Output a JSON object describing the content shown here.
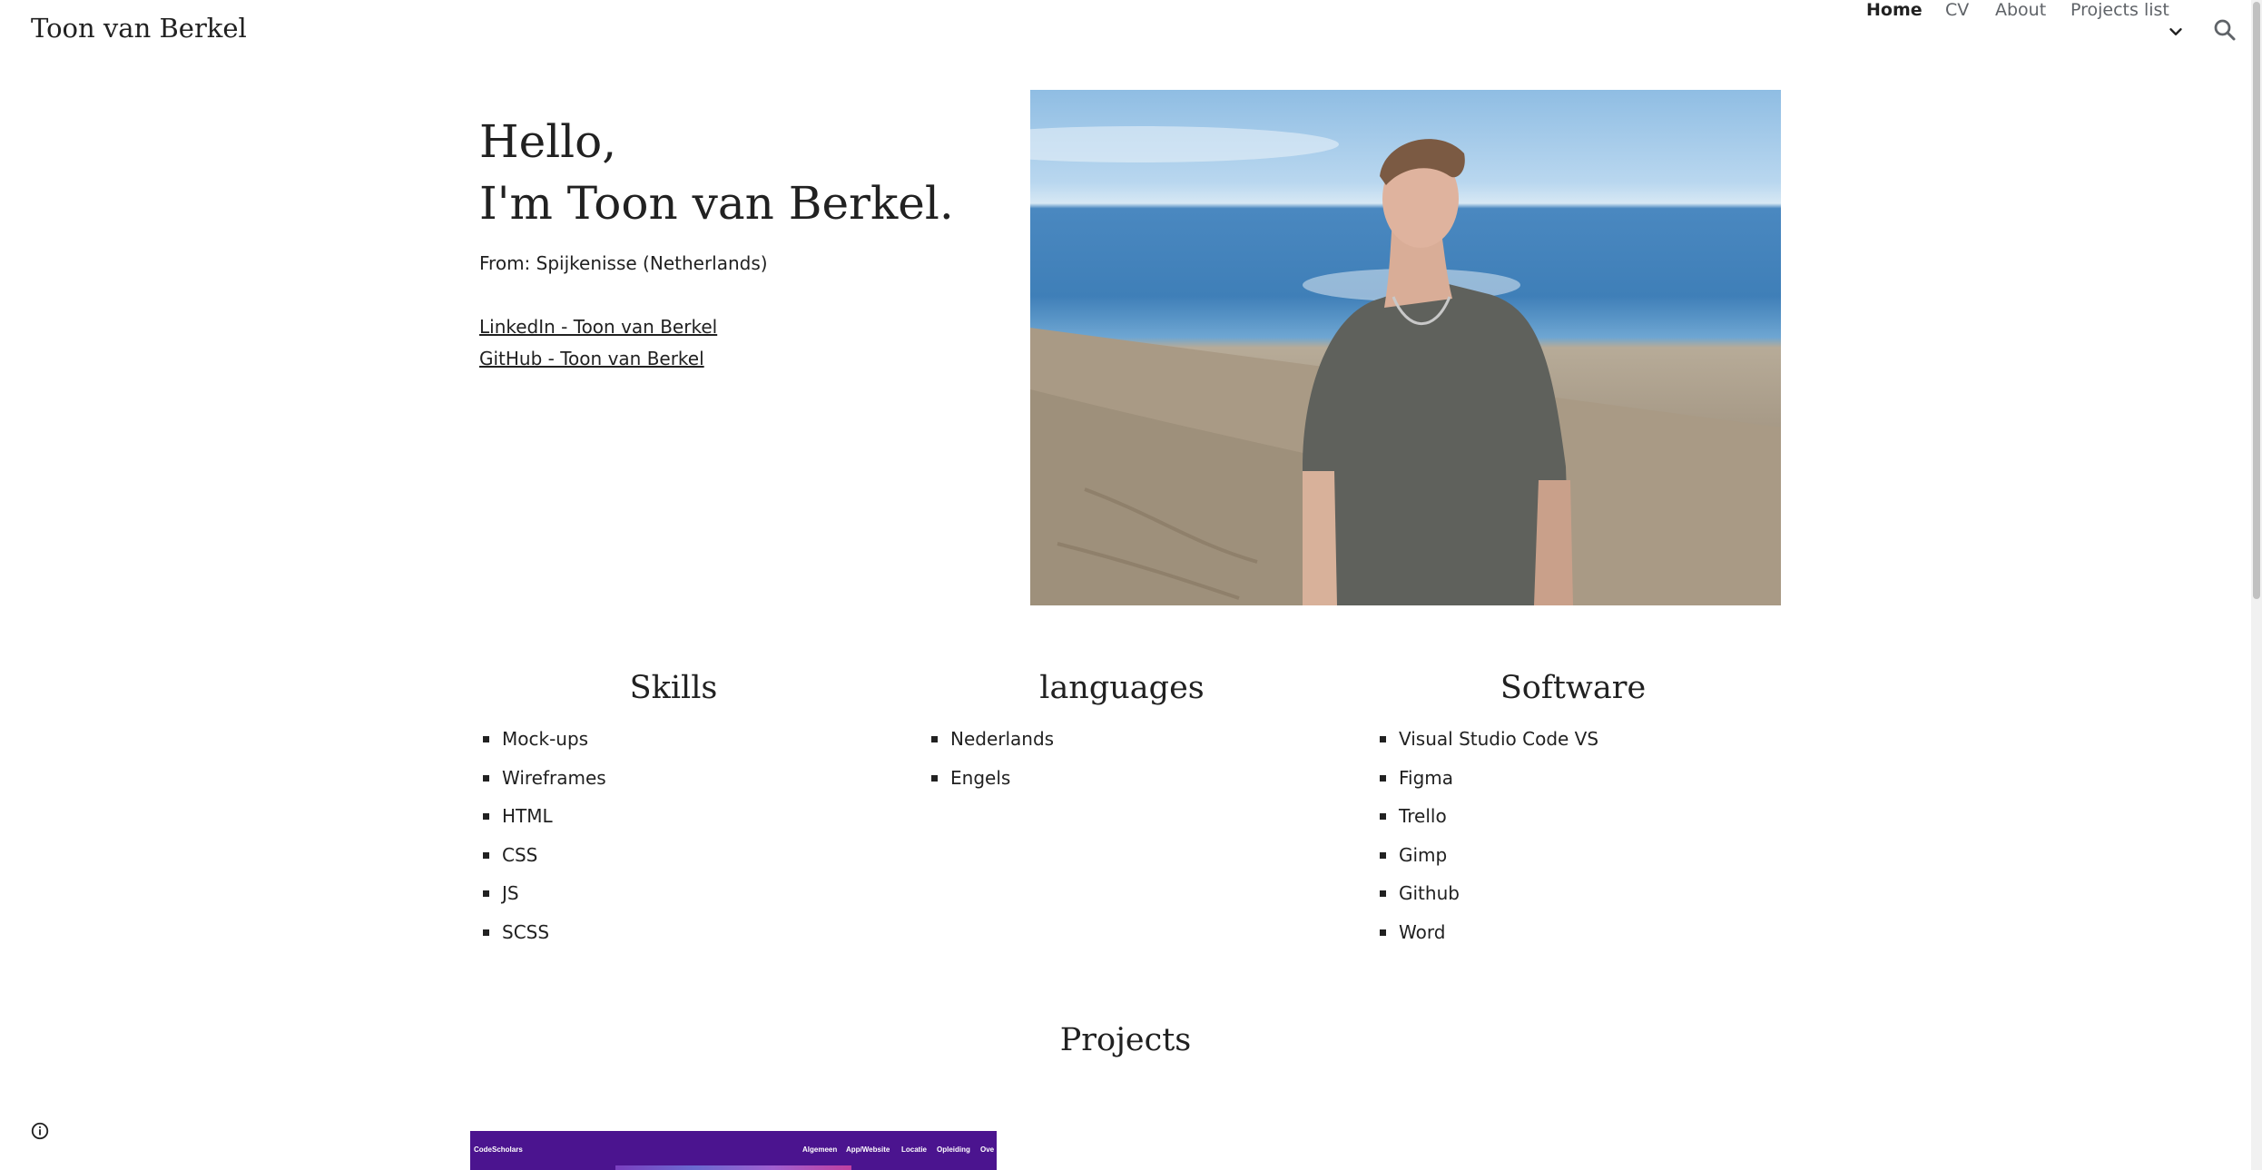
{
  "header": {
    "site_title": "Toon van Berkel",
    "nav": {
      "home": "Home",
      "cv": "CV",
      "about": "About",
      "projects": "Projects list"
    },
    "icons": [
      "chevron-down-icon",
      "search-icon"
    ]
  },
  "intro": {
    "hello": "Hello,",
    "name_line": "I'm Toon van Berkel.",
    "from": "From: Spijkenisse (Netherlands)",
    "linkedin": "LinkedIn - Toon van Berkel",
    "github": "GitHub - Toon van Berkel"
  },
  "skills": {
    "title": "Skills",
    "items": [
      "Mock-ups",
      "Wireframes",
      "HTML",
      "CSS",
      "JS",
      "SCSS"
    ]
  },
  "languages": {
    "title": "languages",
    "items": [
      "Nederlands",
      "Engels"
    ]
  },
  "software": {
    "title": "Software",
    "items": [
      "Visual Studio Code VS",
      "Figma",
      "Trello",
      "Gimp",
      "Github",
      "Word"
    ]
  },
  "projects": {
    "title": "Projects",
    "thumbnail": {
      "brand": "CodeScholars",
      "nav": [
        "Algemeen",
        "App/Website",
        "Locatie",
        "Opleiding",
        "Ove"
      ]
    }
  },
  "colors": {
    "text": "#212121",
    "nav_muted": "#5f6368",
    "thumb_bg": "#4b148f"
  }
}
